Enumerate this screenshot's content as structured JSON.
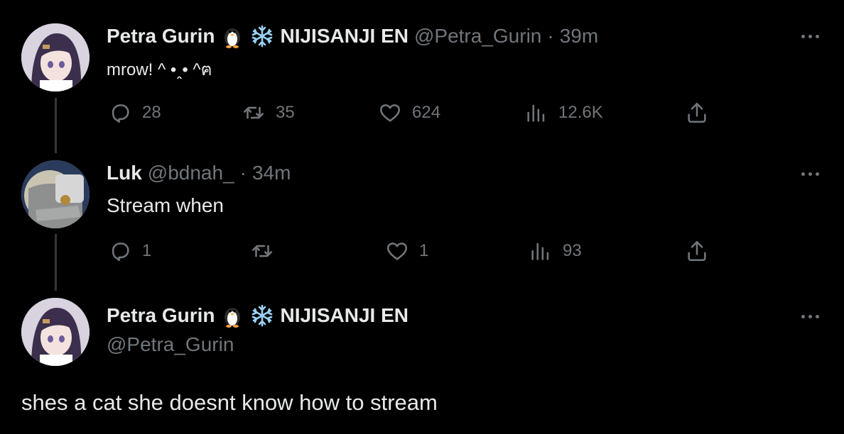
{
  "tweet1": {
    "display_name": "Petra Gurin",
    "emoji1": "penguin-icon",
    "emoji2": "snowflake-icon",
    "org": "NIJISANJI EN",
    "handle": "@Petra_Gurin",
    "separator": "·",
    "time": "39m",
    "text": "mrow! ^ •ꞈ• ^ฅ",
    "replies": "28",
    "retweets": "35",
    "likes": "624",
    "views": "12.6K"
  },
  "tweet2": {
    "display_name": "Luk",
    "handle": "@bdnah_",
    "separator": "·",
    "time": "34m",
    "text": "Stream when",
    "replies": "1",
    "retweets": "",
    "likes": "1",
    "views": "93"
  },
  "tweet3": {
    "display_name": "Petra Gurin",
    "org": "NIJISANJI EN",
    "handle": "@Petra_Gurin",
    "text": "shes a cat she doesnt know how to stream"
  },
  "colors": {
    "background": "#000000",
    "text": "#e7e9ea",
    "muted": "#71767b",
    "thread_line": "#333639",
    "snowflake": "#9ad1f5"
  }
}
